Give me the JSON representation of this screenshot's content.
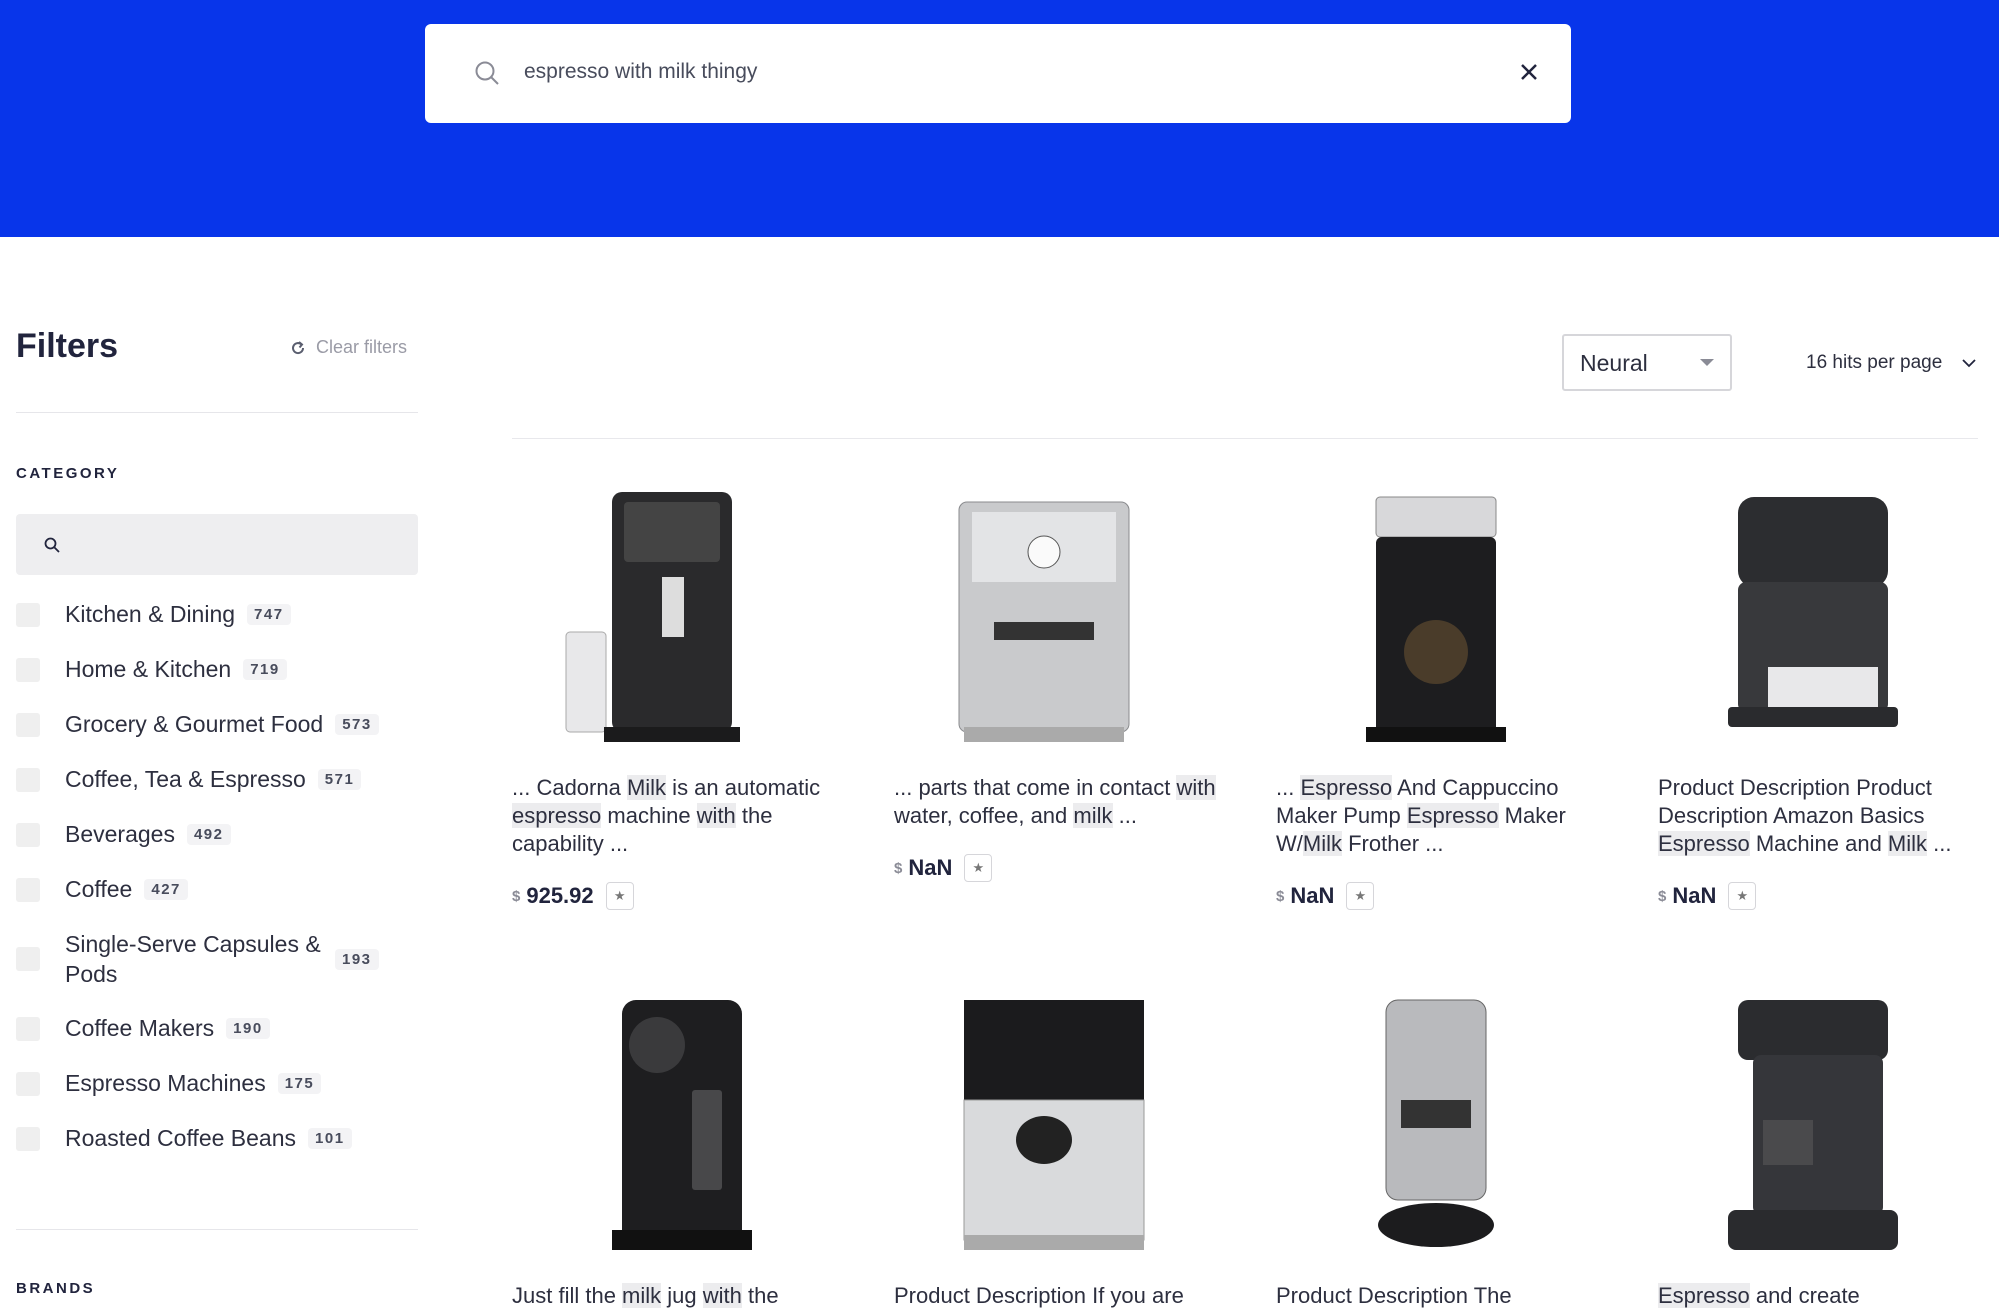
{
  "search": {
    "query": "espresso with milk thingy"
  },
  "sidebar": {
    "title": "Filters",
    "clear_label": "Clear filters",
    "category_heading": "CATEGORY",
    "brands_heading": "BRANDS",
    "categories": [
      {
        "label": "Kitchen & Dining",
        "count": "747"
      },
      {
        "label": "Home & Kitchen",
        "count": "719"
      },
      {
        "label": "Grocery & Gourmet Food",
        "count": "573"
      },
      {
        "label": "Coffee, Tea & Espresso",
        "count": "571"
      },
      {
        "label": "Beverages",
        "count": "492"
      },
      {
        "label": "Coffee",
        "count": "427"
      },
      {
        "label": "Single-Serve Capsules & Pods",
        "count": "193"
      },
      {
        "label": "Coffee Makers",
        "count": "190"
      },
      {
        "label": "Espresso Machines",
        "count": "175"
      },
      {
        "label": "Roasted Coffee Beans",
        "count": "101"
      }
    ]
  },
  "toolbar": {
    "ranking": "Neural",
    "hits_per_page": "16 hits per page"
  },
  "products": [
    {
      "desc_html": "... Cadorna <mark>Milk</mark> is an automatic <mark>espresso</mark> machine <mark>with</mark> the capability ...",
      "currency": "$",
      "price": "925.92"
    },
    {
      "desc_html": "... parts that come in contact <mark>with</mark> water, coffee, and <mark>milk</mark> ...",
      "currency": "$",
      "price": "NaN"
    },
    {
      "desc_html": "... <mark>Espresso</mark> And Cappuccino Maker Pump <mark>Espresso</mark> Maker W/<mark>Milk</mark> Frother ...",
      "currency": "$",
      "price": "NaN"
    },
    {
      "desc_html": "Product Description Product Description Amazon Basics <mark>Espresso</mark> Machine and <mark>Milk</mark> ...",
      "currency": "$",
      "price": "NaN"
    },
    {
      "desc_html": "Just fill the <mark>milk</mark> jug <mark>with</mark> the",
      "currency": "$",
      "price": ""
    },
    {
      "desc_html": "Product Description If you are",
      "currency": "$",
      "price": ""
    },
    {
      "desc_html": "Product Description The",
      "currency": "$",
      "price": ""
    },
    {
      "desc_html": "<mark>Espresso</mark> and create",
      "currency": "$",
      "price": ""
    }
  ]
}
